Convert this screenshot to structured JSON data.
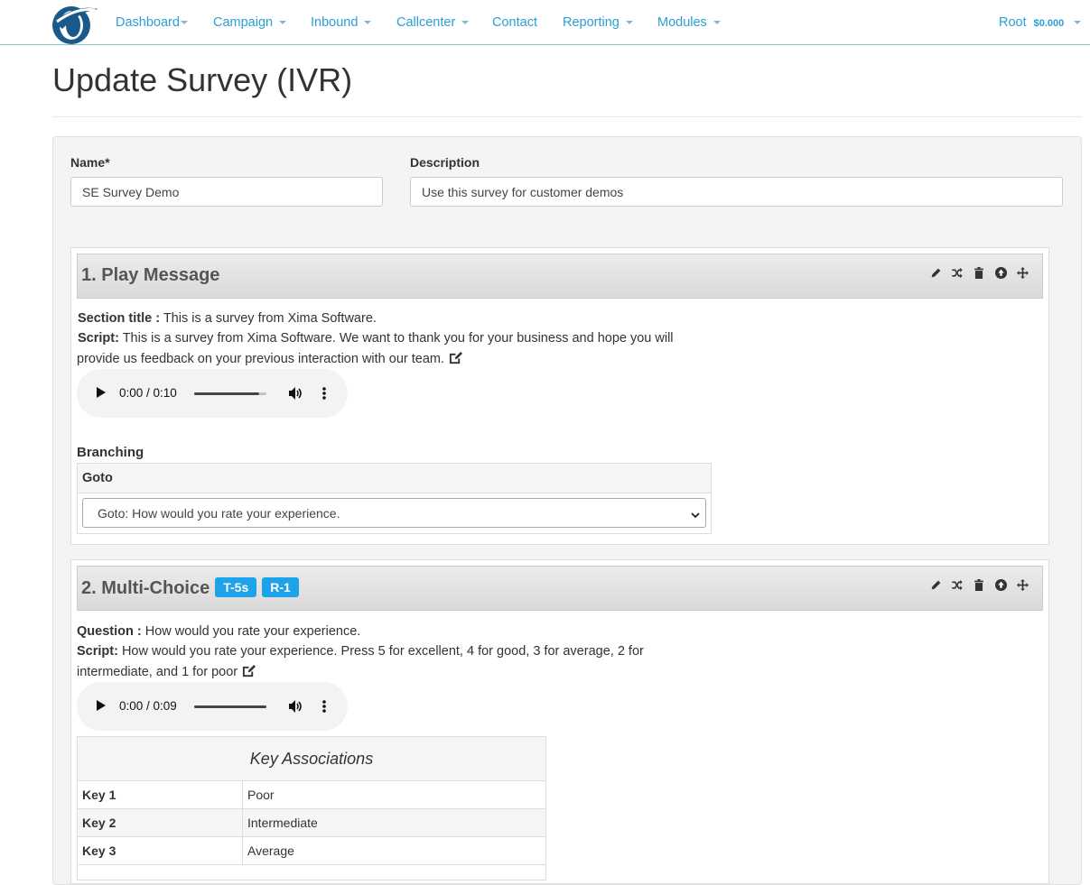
{
  "nav": {
    "items": [
      {
        "label": "Dashboard",
        "caret": true
      },
      {
        "label": "Campaign",
        "caret": true
      },
      {
        "label": "Inbound",
        "caret": true
      },
      {
        "label": "Callcenter",
        "caret": true
      },
      {
        "label": "Contact",
        "caret": false
      },
      {
        "label": "Reporting",
        "caret": true
      },
      {
        "label": "Modules",
        "caret": true
      }
    ],
    "user": "Root",
    "balance": "$0.000",
    "link_color": "#2a9fd6"
  },
  "page": {
    "title": "Update Survey (IVR)"
  },
  "form": {
    "name_label": "Name*",
    "name_value": "SE Survey Demo",
    "description_label": "Description",
    "description_value": "Use this survey for customer demos"
  },
  "sections": [
    {
      "title": "1. Play Message",
      "line1_label": "Section title :",
      "line1_text": "This is a survey from Xima Software.",
      "script_label": "Script:",
      "script_line1": "This is a survey from Xima Software. We want to thank you for your business and hope you will",
      "script_line2": "provide us feedback on your previous interaction with our team.",
      "audio_time": "0:00 / 0:10",
      "audio_volume_level": 0.9,
      "branching_label": "Branching",
      "branch_header": "Goto",
      "branch_select": "Goto: How would you rate your experience."
    },
    {
      "title": "2. Multi-Choice",
      "badges": [
        "T-5s",
        "R-1"
      ],
      "line1_label": "Question :",
      "line1_text": "How would you rate your experience.",
      "script_label": "Script:",
      "script_line1": "How would you rate your experience. Press 5 for excellent, 4 for good, 3 for average, 2 for",
      "script_line2": "intermediate, and 1 for poor",
      "audio_time": "0:00 / 0:09",
      "audio_volume_level": 1.0,
      "key_caption": "Key Associations",
      "keys": [
        {
          "key": "Key 1",
          "value": "Poor"
        },
        {
          "key": "Key 2",
          "value": "Intermediate"
        },
        {
          "key": "Key 3",
          "value": "Average"
        }
      ]
    }
  ],
  "tool_icons": [
    "pencil-icon",
    "shuffle-icon",
    "trash-icon",
    "arrow-up-circle-icon",
    "move-icon"
  ],
  "accent": "#1ea2e8"
}
